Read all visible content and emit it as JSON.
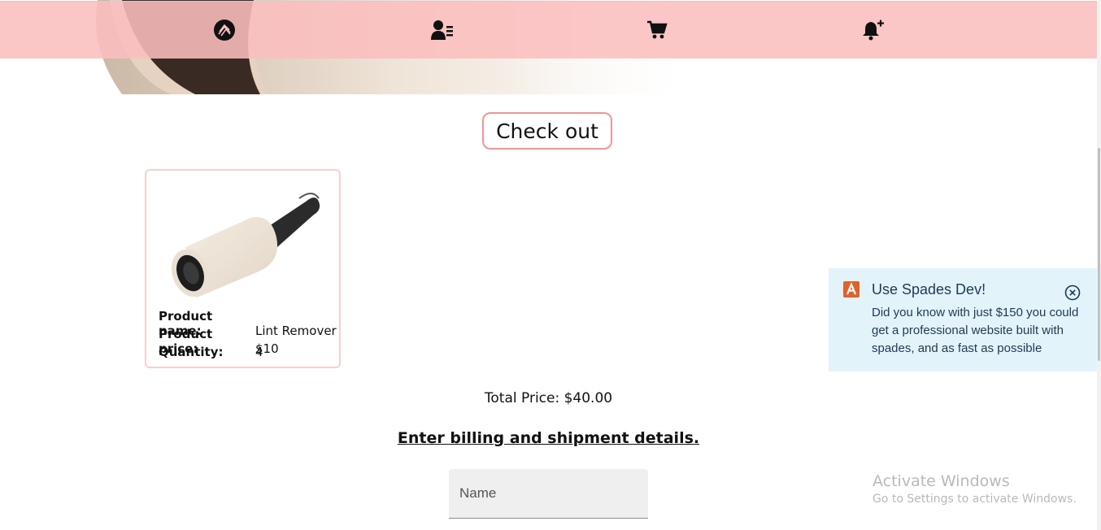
{
  "navbar": {
    "items": [
      {
        "icon": "logo-icon"
      },
      {
        "icon": "user-list-icon"
      },
      {
        "icon": "cart-icon"
      },
      {
        "icon": "bell-plus-icon"
      }
    ],
    "background": "#fbbebe"
  },
  "checkout": {
    "button_label": "Check out",
    "border_color": "#f19595"
  },
  "product": {
    "name_label": "Product name:",
    "name_value": "Lint Remover",
    "price_label": "Product price:",
    "price_value": "$10",
    "quantity_label": "Quantity:",
    "quantity_value": "4",
    "image_icon": "lint-roller-image"
  },
  "summary": {
    "total_price": "Total Price: $40.00"
  },
  "billing": {
    "heading": "Enter billing and shipment details.",
    "name_placeholder": "Name",
    "name_value": ""
  },
  "toast": {
    "icon": "spades-logo-icon",
    "title": "Use Spades Dev!",
    "message": "Did you know with just $150 you could get a professional website built with spades, and as fast as possible",
    "background": "#e3f3fa",
    "accent": "#e0622b"
  },
  "watermark": {
    "title": "Activate Windows",
    "subtitle": "Go to Settings to activate Windows."
  }
}
